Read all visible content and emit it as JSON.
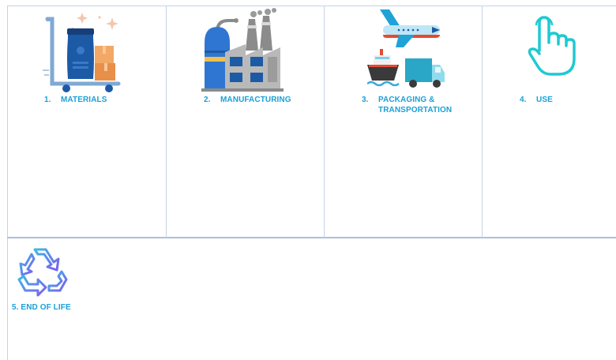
{
  "stages": [
    {
      "number": "1.",
      "label": "MATERIALS",
      "icon": "materials-cart-icon"
    },
    {
      "number": "2.",
      "label": "MANUFACTURING",
      "icon": "factory-icon"
    },
    {
      "number": "3.",
      "label_line1": "PACKAGING &",
      "label_line2": "TRANSPORTATION",
      "icon": "transport-icon"
    },
    {
      "number": "4.",
      "label": "USE",
      "icon": "touch-hand-icon"
    },
    {
      "label": "5. END OF LIFE",
      "icon": "recycle-icon"
    }
  ],
  "colors": {
    "label": "#1aa0d8",
    "grid_line": "#c5d3e6",
    "recycle_gradient_start": "#3fb8e6",
    "recycle_gradient_end": "#7b5cf0",
    "touch_hand": "#1fc9d4"
  }
}
